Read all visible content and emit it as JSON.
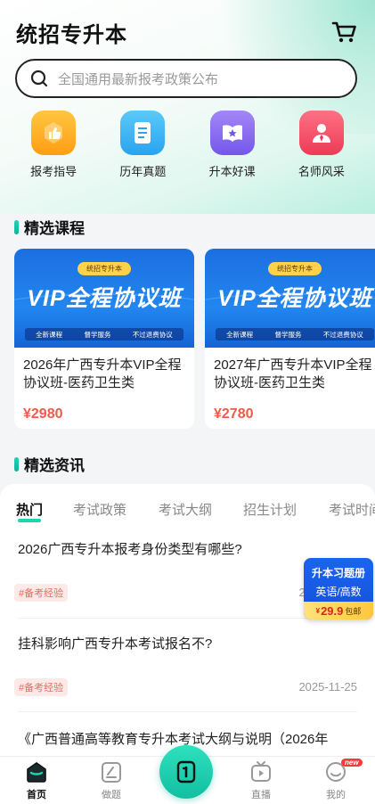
{
  "app": {
    "title": "统招专升本"
  },
  "search": {
    "placeholder": "全国通用最新报考政策公布"
  },
  "quick_menu": [
    {
      "label": "报考指导",
      "icon": "thumbs-up-icon",
      "color": "#ffb020"
    },
    {
      "label": "历年真题",
      "icon": "document-icon",
      "color": "#3ab6f5"
    },
    {
      "label": "升本好课",
      "icon": "star-book-icon",
      "color": "#8a6cf0"
    },
    {
      "label": "名师风采",
      "icon": "teacher-icon",
      "color": "#f2546a"
    }
  ],
  "sections": {
    "courses_title": "精选课程",
    "news_title": "精选资讯"
  },
  "courses": [
    {
      "banner_tag": "统招专升本",
      "banner_title": "VIP全程协议班",
      "banner_features": [
        "全新课程",
        "督学服务",
        "不过退费协议"
      ],
      "name": "2026年广西专升本VIP全程协议班-医药卫生类",
      "price": "¥2980"
    },
    {
      "banner_tag": "统招专升本",
      "banner_title": "VIP全程协议班",
      "banner_features": [
        "全新课程",
        "督学服务",
        "不过退费协议"
      ],
      "name": "2027年广西专升本VIP全程协议班-医药卫生类",
      "price": "¥2780"
    }
  ],
  "news_tabs": [
    "热门",
    "考试政策",
    "考试大纲",
    "招生计划",
    "考试时间"
  ],
  "articles": [
    {
      "title": "2026广西专升本报考身份类型有哪些?",
      "tag": "#备考经验",
      "date": "2025-11-25"
    },
    {
      "title": "挂科影响广西专升本考试报名不?",
      "tag": "#备考经验",
      "date": "2025-11-25"
    },
    {
      "title": "《广西普通高等教育专升本考试大纲与说明（2026年",
      "tag": "",
      "date": ""
    }
  ],
  "promo": {
    "title": "升本习题册",
    "subtitle": "英语/高数",
    "currency": "¥",
    "price": "29.9",
    "note": "包邮"
  },
  "tabbar": [
    {
      "label": "首页",
      "icon": "home-icon"
    },
    {
      "label": "做题",
      "icon": "practice-icon"
    },
    {
      "label": "",
      "icon": "book-center-icon"
    },
    {
      "label": "直播",
      "icon": "live-tv-icon"
    },
    {
      "label": "我的",
      "icon": "profile-icon",
      "badge": "new"
    }
  ],
  "colors": {
    "accent": "#1fd4b0",
    "price": "#f05a4a",
    "tag_bg": "#fde9e8",
    "tag_text": "#ef6a5a"
  }
}
